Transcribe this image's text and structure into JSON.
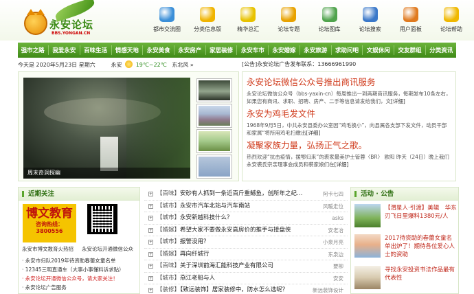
{
  "site": {
    "name": "永安论坛",
    "url": "BBS.YONGAN.CN"
  },
  "topnav": [
    {
      "label": "都市交流圈",
      "icon": "chat-bubble-icon",
      "color": "#3b8fd8"
    },
    {
      "label": "分类信息版",
      "icon": "folder-arrow-icon",
      "color": "#f0b400"
    },
    {
      "label": "精华总汇",
      "icon": "star-icon",
      "color": "#e8c200"
    },
    {
      "label": "论坛专题",
      "icon": "document-icon",
      "color": "#e8a200"
    },
    {
      "label": "论坛图库",
      "icon": "picture-frame-icon",
      "color": "#4fa34c"
    },
    {
      "label": "论坛搜索",
      "icon": "magnifier-icon",
      "color": "#3a78c9"
    },
    {
      "label": "用户面板",
      "icon": "palette-icon",
      "color": "#e07a1f"
    },
    {
      "label": "论坛帮助",
      "icon": "gear-help-icon",
      "color": "#f0b800"
    }
  ],
  "mainnav": [
    "强市之路",
    "我爱永安",
    "百味生活",
    "情感天地",
    "永安美食",
    "永安房产",
    "家居装修",
    "永安车市",
    "永安婚嫁",
    "永安旅游",
    "求助问吧",
    "文娱休闲",
    "交友群组",
    "分类资讯"
  ],
  "infobar": {
    "date": "今天是 2020年5月23日 星期六",
    "city": "永安",
    "temp": "19℃~22℃",
    "wind": "东北风 »"
  },
  "notice": "[公告]永安论坛广告发布联系：13666961990",
  "slideshow": {
    "caption": "周末奇洞探幽"
  },
  "news": [
    {
      "title": "永安论坛微信公众号推出商讯服务",
      "desc": "永安论坛微信公众号（bbs-yaxin-cn）每周推出一到两期商讯服务，每期发布10条左右，如果您有商讯、求职、招聘、房产、二手等信息请发给我们，文",
      "more": "[详细]"
    },
    {
      "title": "永安为鸡毛发文件",
      "desc": "1968年9月5日，中共永安县委办公室因“鸡毛换小”，向县属各支部下发文件，动员干部和家属“将所用鸡毛扫缴出",
      "more": "[详细]"
    },
    {
      "title": "凝聚家族力量，弘扬正气之歌。",
      "desc": "热烈欢迎“抗击疫情，援鄂归来”的裘家最美护士管蓉〈BR〉  欧阳  昨天（24日）晚上我们永安裘氏宗亲理事会成员和裘家娘们在",
      "more": "[详细]"
    }
  ],
  "recent": {
    "title": "近期关注",
    "ad1": {
      "big": "博文教育",
      "tel": "咨询热线：3800556"
    },
    "ad1_caption": "永安市博文教育火热招",
    "qr_caption": "永安论坛开通微信公众",
    "items": [
      {
        "text": "· 永安市归队2019年待资助春蕾女童名单",
        "red": false
      },
      {
        "text": "· 12345三明直通车（大事小事懂料诉求贴）",
        "red": false
      },
      {
        "text": "· 永安论坛开通微信公众号，请大家关注！",
        "red": true
      },
      {
        "text": "· 永安论坛广告服务",
        "red": false
      }
    ]
  },
  "threads": [
    {
      "tag": "【百味】",
      "title": "安砂有人抓到一条近百斤重鳡鱼，创所年之纪…",
      "author": "阿卡七四"
    },
    {
      "tag": "【城市】",
      "title": "永安市汽车北站与汽车南站",
      "author": "风暖走位"
    },
    {
      "tag": "【城市】",
      "title": "永安新越科技什么？",
      "author": "asks"
    },
    {
      "tag": "【婚嫁】",
      "title": "希望大家不要做永安高房价的推手与接盘侠",
      "author": "安老冶"
    },
    {
      "tag": "【城市】",
      "title": "报警没用？",
      "author": "小泉月亮"
    },
    {
      "tag": "【婚嫁】",
      "title": "再向纤城行",
      "author": "东泉边"
    },
    {
      "tag": "【百味】",
      "title": "关于深圳前海汇能科技产业有限公司",
      "author": "要柳"
    },
    {
      "tag": "【城市】",
      "title": "燕江老船与人",
      "author": "安安"
    },
    {
      "tag": "【装修】",
      "title": "【致远装饰】居家装修中，防水怎么选呢？",
      "author": "新远装饰设计"
    }
  ],
  "activities": {
    "title": "活动 · 公告",
    "items": [
      {
        "text": "【渭星人·引渡】美辑　华东刃飞日里爆料1380元/人"
      },
      {
        "text": "2017待资助的春蕾女童名单出炉了！期待各位爱心人士的资助"
      },
      {
        "text": "寻找永安投资书法作品最有代表性"
      }
    ]
  }
}
